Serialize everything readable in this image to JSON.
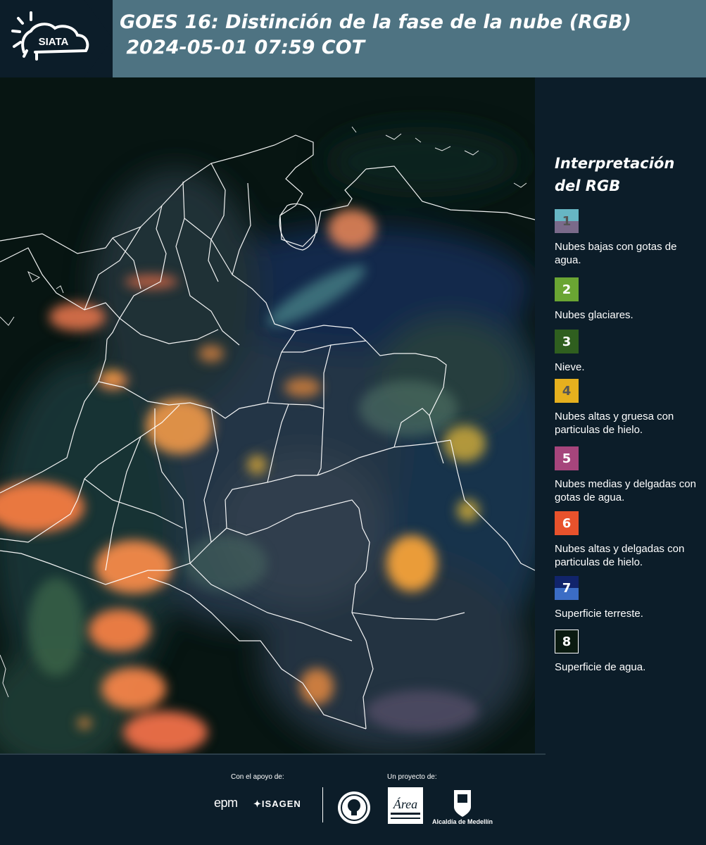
{
  "header": {
    "logo_text": "SIATA",
    "title_line1": "GOES 16: Distinción de la fase de la nube (RGB)",
    "title_line2": " 2024-05-01 07:59 COT"
  },
  "legend": {
    "title": "Interpretación del RGB",
    "items": [
      {
        "number": "1",
        "label": "Nubes bajas con gotas de agua.",
        "color_top": "#67b6c4",
        "color_bottom": "#7a6a8a",
        "text_color": "#555555"
      },
      {
        "number": "2",
        "label": "Nubes glaciares.",
        "color_top": "#6aa533",
        "color_bottom": "#6aa533",
        "text_color": "#ffffff"
      },
      {
        "number": "3",
        "label": "Nieve.",
        "color_top": "#2f5f1f",
        "color_bottom": "#2f5f1f",
        "text_color": "#ffffff"
      },
      {
        "number": "4",
        "label": "Nubes altas y gruesa con particulas de hielo.",
        "color_top": "#e6b01e",
        "color_bottom": "#e6b01e",
        "text_color": "#555555"
      },
      {
        "number": "5",
        "label": "Nubes medias y delgadas con gotas de agua.",
        "color_top": "#a6457c",
        "color_bottom": "#a6457c",
        "text_color": "#ffffff"
      },
      {
        "number": "6",
        "label": "Nubes altas y delgadas con particulas de hielo.",
        "color_top": "#e8522c",
        "color_bottom": "#e8522c",
        "text_color": "#ffffff"
      },
      {
        "number": "7",
        "label": "Superficie terreste.",
        "color_top": "#11246b",
        "color_bottom": "#3b6dc5",
        "text_color": "#ffffff"
      },
      {
        "number": "8",
        "label": "Superficie de agua.",
        "color_top": "#0a1a10",
        "color_bottom": "#0a1a10",
        "text_color": "#ffffff"
      }
    ]
  },
  "footer": {
    "support_label": "Con el apoyo de:",
    "project_label": "Un proyecto de:",
    "sponsor1": "epm",
    "sponsor2": "ISAGEN",
    "metro_label": "Área",
    "alcaldia_label": "Alcaldía de Medellín"
  }
}
